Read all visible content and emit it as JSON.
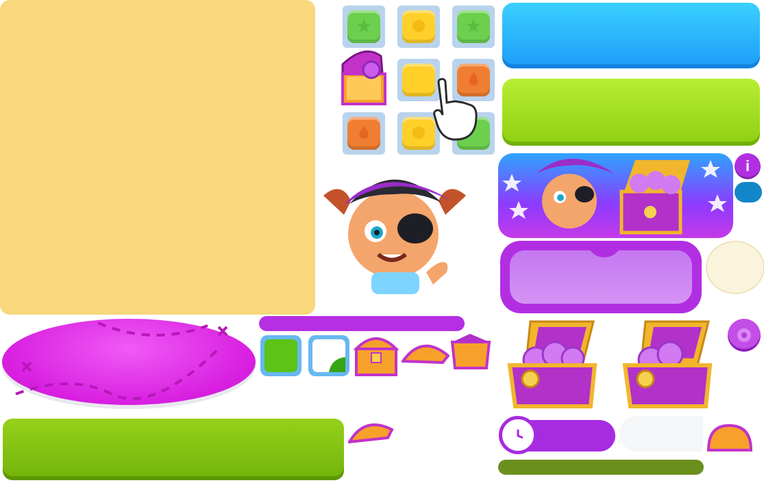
{
  "info_button": {
    "label": "i"
  },
  "colors": {
    "sand_panel": "#f8d77d",
    "blue_button": "#1d9cf8",
    "lime_button": "#8fcf0f",
    "purple_panel": "#b22ee2",
    "pink_oval": "#d81fe0",
    "green_button": "#73b30b",
    "olive_bar": "#6b8f1c",
    "timer": "#a72be0"
  },
  "tutorial_grid": {
    "tiles": [
      "green-star",
      "yellow-flower",
      "green-star",
      "empty",
      "yellow-flower",
      "orange-fire",
      "orange-fire",
      "yellow-flower",
      "green-star"
    ]
  },
  "icons": [
    "treasure-chest-icon",
    "hand-pointer-icon",
    "pirate-girl-icon",
    "coin-icon",
    "clock-icon",
    "star-icon"
  ]
}
